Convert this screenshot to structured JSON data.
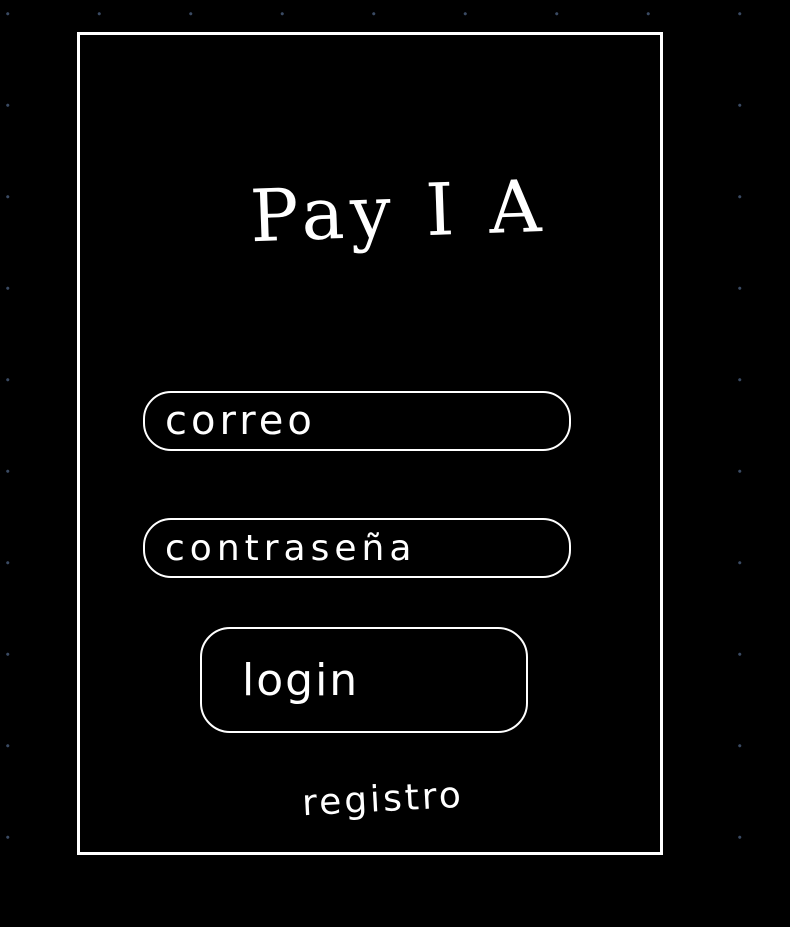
{
  "app": {
    "title": "Pay I A"
  },
  "login_form": {
    "email": {
      "placeholder": "correo",
      "value": ""
    },
    "password": {
      "placeholder": "contraseña",
      "value": ""
    },
    "login_label": "login",
    "register_label": "registro"
  },
  "colors": {
    "background": "#000000",
    "foreground": "#ffffff",
    "grid_dot": "#3a4a63"
  }
}
